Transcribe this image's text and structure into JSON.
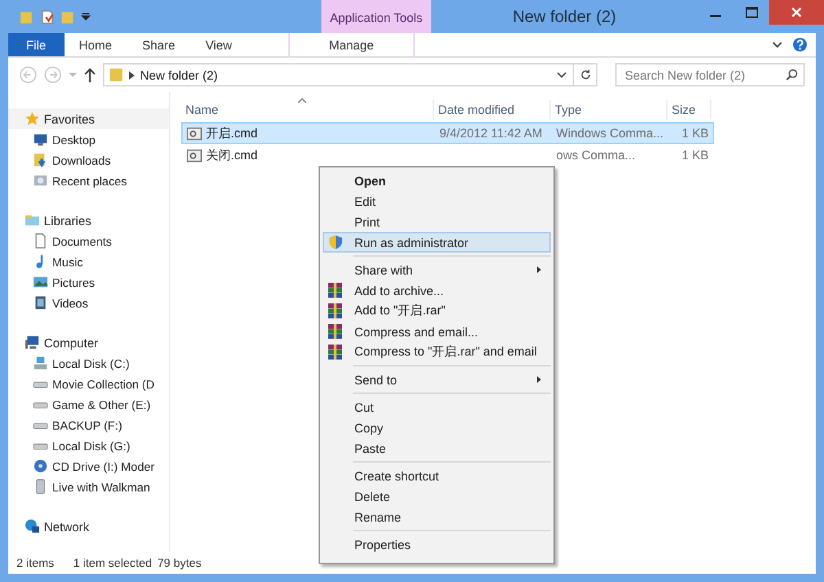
{
  "window": {
    "title": "New folder (2)",
    "contextual_group": "Application Tools"
  },
  "ribbon": {
    "tabs": [
      {
        "label": "File",
        "kind": "file",
        "selected": false
      },
      {
        "label": "Home",
        "kind": "tab",
        "selected": false
      },
      {
        "label": "Share",
        "kind": "tab",
        "selected": false
      },
      {
        "label": "View",
        "kind": "tab",
        "selected": false
      },
      {
        "label": "Manage",
        "kind": "contextual",
        "selected": false
      }
    ]
  },
  "address_bar": {
    "path": "New folder (2)"
  },
  "search": {
    "placeholder": "Search New folder (2)"
  },
  "sidebar": {
    "groups": [
      {
        "label": "Favorites",
        "kind": "star",
        "children": [
          {
            "label": "Desktop",
            "kind": "desktop"
          },
          {
            "label": "Downloads",
            "kind": "download"
          },
          {
            "label": "Recent places",
            "kind": "recent"
          }
        ]
      },
      {
        "label": "Libraries",
        "kind": "library",
        "children": [
          {
            "label": "Documents",
            "kind": "document"
          },
          {
            "label": "Music",
            "kind": "music"
          },
          {
            "label": "Pictures",
            "kind": "picture"
          },
          {
            "label": "Videos",
            "kind": "video"
          }
        ]
      },
      {
        "label": "Computer",
        "kind": "computer",
        "children": [
          {
            "label": "Local Disk (C:)",
            "kind": "system-drive"
          },
          {
            "label": "Movie Collection (D",
            "kind": "drive"
          },
          {
            "label": "Game & Other (E:)",
            "kind": "drive"
          },
          {
            "label": "BACKUP (F:)",
            "kind": "drive"
          },
          {
            "label": "Local Disk (G:)",
            "kind": "drive"
          },
          {
            "label": "CD Drive (I:) Moder",
            "kind": "cd"
          },
          {
            "label": "Live with Walkman",
            "kind": "device"
          }
        ]
      },
      {
        "label": "Network",
        "kind": "network"
      }
    ]
  },
  "file_list": {
    "columns": [
      "Name",
      "Date modified",
      "Type",
      "Size"
    ],
    "rows": [
      {
        "name": "开启.cmd",
        "date_modified": "9/4/2012 11:42 AM",
        "type": "Windows Comma...",
        "size": "1 KB",
        "selected": true
      },
      {
        "name": "关闭.cmd",
        "type": "ows Comma...",
        "size": "1 KB",
        "selected": false
      }
    ]
  },
  "context_menu": {
    "sections": [
      [
        {
          "label": "Open",
          "kind": "default",
          "selected": false
        },
        {
          "label": "Edit",
          "kind": "plain",
          "selected": false
        },
        {
          "label": "Print",
          "kind": "plain",
          "selected": false
        },
        {
          "label": "Run as administrator",
          "kind": "shield",
          "selected": true
        }
      ],
      [
        {
          "label": "Share with",
          "kind": "submenu",
          "selected": false
        },
        {
          "label": "Add to archive...",
          "kind": "archive",
          "selected": false
        },
        {
          "label": "Add to \"开启.rar\"",
          "kind": "archive",
          "selected": false
        },
        {
          "label": "Compress and email...",
          "kind": "archive",
          "selected": false
        },
        {
          "label": "Compress to \"开启.rar\" and email",
          "kind": "archive",
          "selected": false
        }
      ],
      [
        {
          "label": "Send to",
          "kind": "submenu",
          "selected": false
        }
      ],
      [
        {
          "label": "Cut",
          "kind": "plain",
          "selected": false
        },
        {
          "label": "Copy",
          "kind": "plain",
          "selected": false
        },
        {
          "label": "Paste",
          "kind": "plain",
          "selected": false
        }
      ],
      [
        {
          "label": "Create shortcut",
          "kind": "plain",
          "selected": false
        },
        {
          "label": "Delete",
          "kind": "plain",
          "selected": false
        },
        {
          "label": "Rename",
          "kind": "plain",
          "selected": false
        }
      ],
      [
        {
          "label": "Properties",
          "kind": "plain",
          "selected": false
        }
      ]
    ]
  },
  "status_bar": {
    "item_count": "2 items",
    "selection": "1 item selected",
    "size": "79 bytes"
  }
}
